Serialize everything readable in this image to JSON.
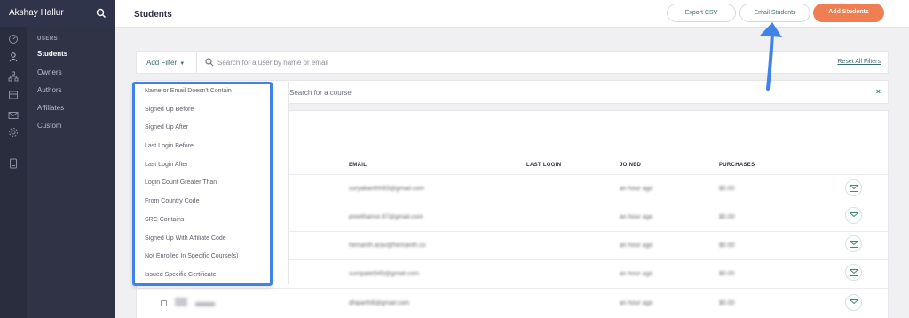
{
  "sidebar": {
    "user_name": "Akshay Hallur",
    "section_heading": "USERS",
    "items": [
      {
        "label": "Students",
        "active": true
      },
      {
        "label": "Owners",
        "active": false
      },
      {
        "label": "Authors",
        "active": false
      },
      {
        "label": "Affiliates",
        "active": false
      },
      {
        "label": "Custom",
        "active": false
      }
    ],
    "rail_icons": [
      "dashboard-icon",
      "users-icon",
      "sitemap-icon",
      "store-icon",
      "mail-icon",
      "settings-icon",
      "book-icon"
    ]
  },
  "header": {
    "title": "Students",
    "export_label": "Export CSV",
    "email_label": "Email Students",
    "add_label": "Add Students"
  },
  "filter_bar": {
    "add_filter_label": "Add Filter",
    "search_placeholder": "Search for a user by name or email",
    "reset_label": "Reset All Filters"
  },
  "course_bar": {
    "placeholder": "Search for a course",
    "close": "×"
  },
  "filter_menu": {
    "items": [
      "Name or Email Doesn't Contain",
      "Signed Up Before",
      "Signed Up After",
      "Last Login Before",
      "Last Login After",
      "Login Count Greater Than",
      "From Country Code",
      "SRC Contains",
      "Signed Up With Affiliate Code",
      "Not Enrolled In Specific Course(s)",
      "Issued Specific Certificate"
    ]
  },
  "table": {
    "columns": [
      "EMAIL",
      "LAST LOGIN",
      "JOINED",
      "PURCHASES"
    ],
    "rows": [
      {
        "email": "suryakanthh83@gmail.com",
        "joined": "an hour ago",
        "purchases": "$0.00"
      },
      {
        "email": "preethamsr.87@gmail.com",
        "joined": "an hour ago",
        "purchases": "$0.00"
      },
      {
        "email": "hemanth.arav@hemanth.co",
        "joined": "an hour ago",
        "purchases": "$0.00"
      },
      {
        "email": "sumpatel345@gmail.com",
        "joined": "an hour ago",
        "purchases": "$0.00"
      },
      {
        "email": "dhiparth8@gmail.com",
        "joined": "an hour ago",
        "purchases": "$0.00"
      }
    ]
  },
  "colors": {
    "accent": "#ef7e52",
    "teal": "#3d6d6a",
    "highlight": "#3f83e8",
    "sidebar": "#2f3345"
  }
}
